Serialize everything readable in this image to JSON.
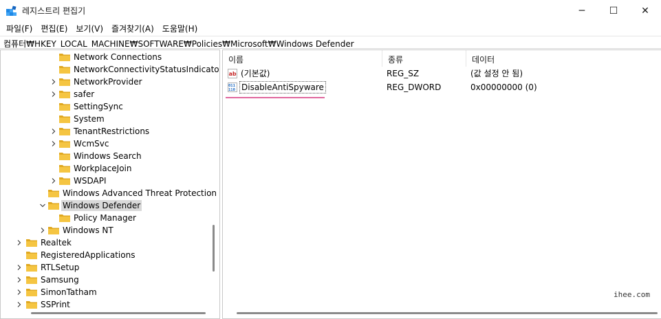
{
  "window": {
    "title": "레지스트리 편집기",
    "minimize_glyph": "─",
    "maximize_glyph": "☐",
    "close_glyph": "✕"
  },
  "menu": [
    "파일(F)",
    "편집(E)",
    "보기(V)",
    "즐겨찾기(A)",
    "도움말(H)"
  ],
  "address": "컴퓨터₩HKEY_LOCAL_MACHINE₩SOFTWARE₩Policies₩Microsoft₩Windows Defender",
  "tree": [
    {
      "label": "Network Connections",
      "expander": false
    },
    {
      "label": "NetworkConnectivityStatusIndicator",
      "expander": false
    },
    {
      "label": "NetworkProvider",
      "expander": true
    },
    {
      "label": "safer",
      "expander": true
    },
    {
      "label": "SettingSync",
      "expander": false
    },
    {
      "label": "System",
      "expander": false
    },
    {
      "label": "TenantRestrictions",
      "expander": true
    },
    {
      "label": "WcmSvc",
      "expander": true
    },
    {
      "label": "Windows Search",
      "expander": false
    },
    {
      "label": "WorkplaceJoin",
      "expander": false
    },
    {
      "label": "WSDAPI",
      "expander": true
    },
    {
      "label": "Windows Advanced Threat Protection",
      "expander": false
    },
    {
      "label": "Windows Defender",
      "expander": "open",
      "selected": true
    },
    {
      "label": "Policy Manager",
      "expander": false
    },
    {
      "label": "Windows NT",
      "expander": true
    },
    {
      "label": "Realtek",
      "expander": true
    },
    {
      "label": "RegisteredApplications",
      "expander": false
    },
    {
      "label": "RTLSetup",
      "expander": true
    },
    {
      "label": "Samsung",
      "expander": true
    },
    {
      "label": "SimonTatham",
      "expander": true
    },
    {
      "label": "SSPrint",
      "expander": true
    }
  ],
  "list": {
    "columns": {
      "name": "이름",
      "type": "종류",
      "data": "데이터"
    },
    "rows": [
      {
        "icon": "string-value-icon",
        "name": "(기본값)",
        "type": "REG_SZ",
        "data": "(값 설정 안 됨)"
      },
      {
        "icon": "dword-value-icon",
        "name": "DisableAntiSpyware",
        "type": "REG_DWORD",
        "data": "0x00000000 (0)",
        "focused": true
      }
    ]
  },
  "watermark": "ihee.com",
  "colors": {
    "folder": "#f5c542",
    "folder_dark": "#e0a820",
    "selection": "#d9d9d9",
    "highlight_underline": "#e0679e",
    "app_icon": "#1e88e5"
  }
}
